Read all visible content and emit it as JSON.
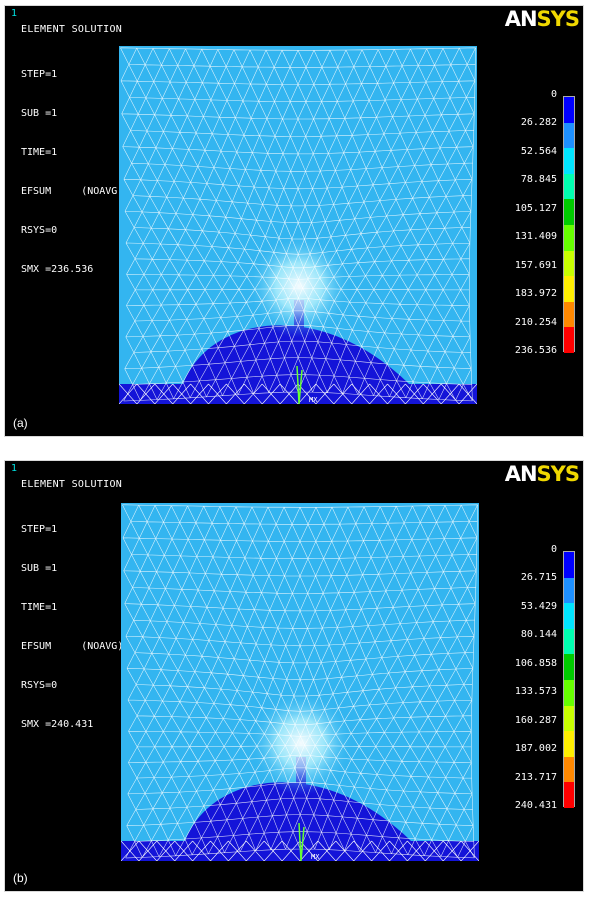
{
  "panels": [
    {
      "window_number": "1",
      "title": "ELEMENT SOLUTION",
      "info_lines": [
        "STEP=1",
        "SUB =1",
        "TIME=1",
        "EFSUM     (NOAVG)",
        "RSYS=0",
        "SMX =236.536"
      ],
      "logo_an": "AN",
      "logo_sys": "SYS",
      "caption": "(a)",
      "mark_label": "MX",
      "legend_values": [
        "0",
        "26.282",
        "52.564",
        "78.845",
        "105.127",
        "131.409",
        "157.691",
        "183.972",
        "210.254",
        "236.536"
      ]
    },
    {
      "window_number": "1",
      "title": "ELEMENT SOLUTION",
      "info_lines": [
        "STEP=1",
        "SUB =1",
        "TIME=1",
        "EFSUM     (NOAVG)",
        "RSYS=0",
        "SMX =240.431"
      ],
      "logo_an": "AN",
      "logo_sys": "SYS",
      "caption": "(b)",
      "mark_label": "MX",
      "legend_values": [
        "0",
        "26.715",
        "53.429",
        "80.144",
        "106.858",
        "133.573",
        "160.287",
        "187.002",
        "213.717",
        "240.431"
      ]
    }
  ],
  "legend_colors": [
    "#0000ff",
    "#1e90ff",
    "#00e5ff",
    "#00ffb0",
    "#00cc00",
    "#66ff00",
    "#c8ff00",
    "#ffee00",
    "#ff8800",
    "#ff0000"
  ],
  "mesh_colors": {
    "field": "#33b5f0",
    "hump": "#1414d8",
    "mesh_lines": "#ffffff",
    "hotspot": "#e8ffff"
  }
}
